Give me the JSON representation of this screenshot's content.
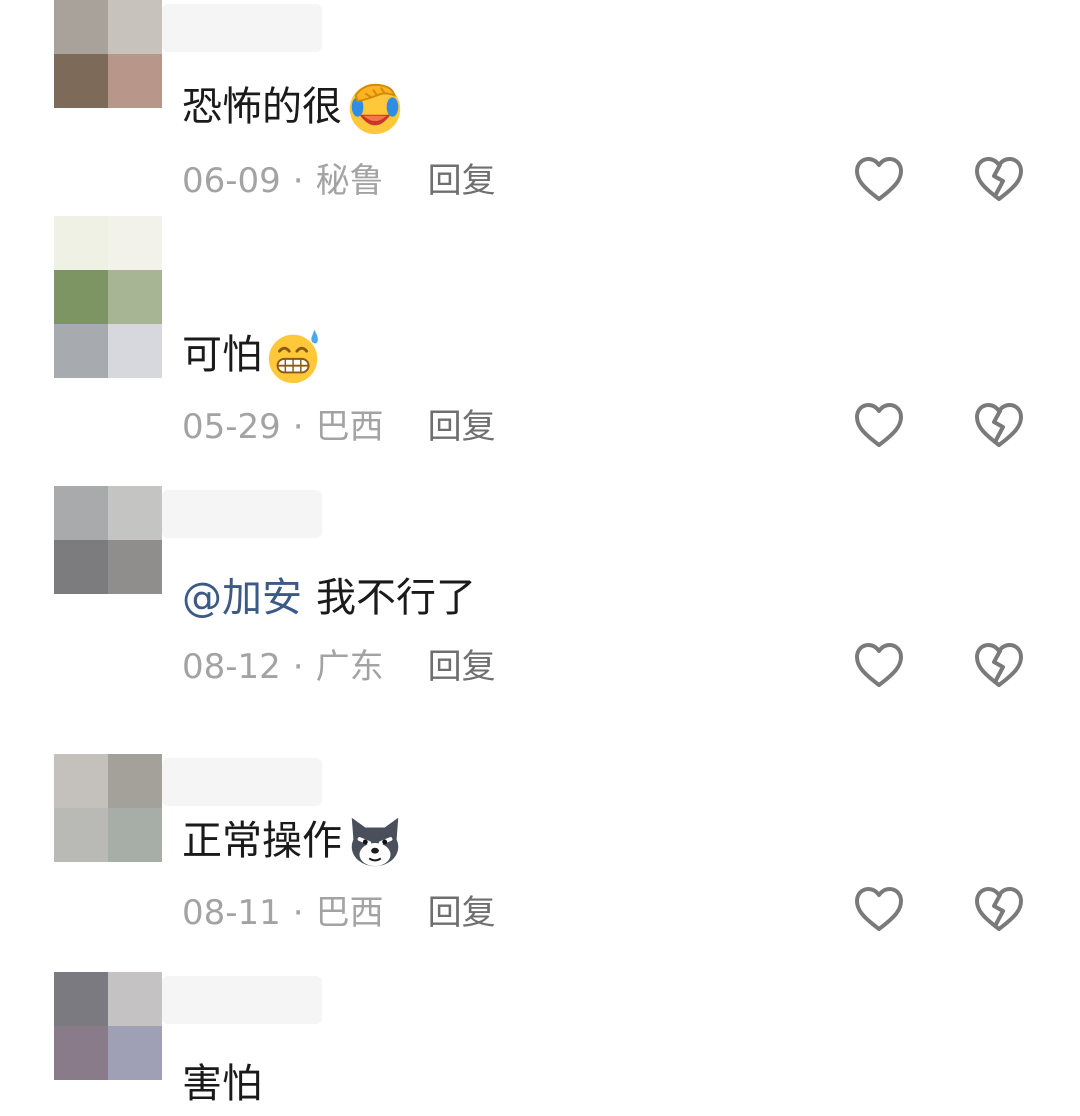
{
  "comments": [
    {
      "text": "恐怖的很",
      "mention": "",
      "emoji": "face-palm-laughing-emoji",
      "date": "06-09",
      "location": "秘鲁",
      "reply_label": "回复",
      "avatar_colors": [
        "#a8a29a",
        "#c8c2bc",
        "#7e6a58",
        "#b9968a"
      ]
    },
    {
      "text": "可怕",
      "mention": "",
      "emoji": "grimacing-sweat-emoji",
      "date": "05-29",
      "location": "巴西",
      "reply_label": "回复",
      "avatar_colors": [
        "#eef1e4",
        "#f2f2ea",
        "#7d9463",
        "#a7b594"
      ]
    },
    {
      "text": "我不行了",
      "mention": "@加安",
      "emoji": "",
      "date": "08-12",
      "location": "广东",
      "reply_label": "回复",
      "avatar_colors": [
        "#a9aaab",
        "#c4c4c2",
        "#7c7b7d",
        "#8f8e8c"
      ]
    },
    {
      "text": "正常操作",
      "mention": "",
      "emoji": "husky-dog-emoji",
      "date": "08-11",
      "location": "巴西",
      "reply_label": "回复",
      "avatar_colors": [
        "#c4c1bd",
        "#a4a09a",
        "#b9b9b6",
        "#a7ada7"
      ]
    },
    {
      "text": "害怕",
      "mention": "",
      "emoji": "",
      "date": "",
      "location": "",
      "reply_label": "",
      "avatar_colors": [
        "#7b7a80",
        "#c4c2c3",
        "#8a7b8a",
        "#9fa0b5"
      ]
    }
  ],
  "icons": {
    "like": "heart-outline-icon",
    "dislike": "broken-heart-icon"
  }
}
